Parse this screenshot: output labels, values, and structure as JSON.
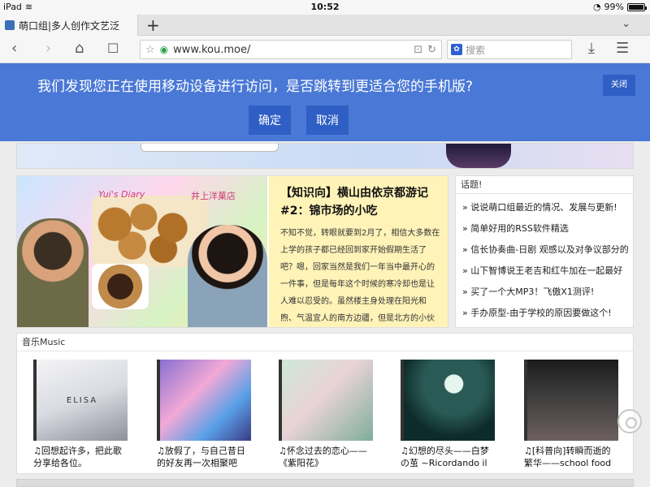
{
  "status_bar": {
    "device": "iPad",
    "time": "10:52",
    "battery": "99%",
    "battery_level": 0.99
  },
  "browser": {
    "tab_title": "萌口组|多人创作文艺泛",
    "new_tab": "+",
    "url": "www.kou.moe/",
    "search_placeholder": "搜索",
    "search_engine_icon": "baidu-paw-icon"
  },
  "overlay": {
    "message": "我们发现您正在使用移动设备进行访问，是否跳转到更适合您的手机版?",
    "confirm": "确定",
    "cancel": "取消",
    "close": "关闭",
    "accent_color": "#4a78d6"
  },
  "feature": {
    "image_caption": "Yui's Diary",
    "image_caption2": "井上洋菓店",
    "title": "【知识向】横山由依京都游记#2：锦市场的小吃",
    "body": "不知不觉，转眼就要到2月了，相信大多数在上学的孩子都已经回到家开始假期生活了吧？嗯，回家当然是我们一年当中最开心的一件事，但是每年这个时候的寒冷却也是让人难以忍受的。虽然楼主身处理在阳光和煦、气温宜人的南方边疆，但是北方的小伙伴们的心情多"
  },
  "topics": {
    "heading": "话题!",
    "items": [
      "» 说说萌口组最近的情况、发展与更新!",
      "» 简单好用的RSS软件精选",
      "» 信长协奏曲-日剧 观感以及对争议部分的",
      "» 山下智博说王老吉和红牛加在一起最好",
      "» 买了一个大MP3！飞傲X1测评!",
      "» 手办原型-由于学校的原因要做这个!"
    ]
  },
  "music": {
    "heading": "音乐Music",
    "items": [
      {
        "cover_text": "ELISA",
        "caption": "♫回想起许多，把此歌分享给各位。"
      },
      {
        "cover_text": "",
        "caption": "♫放假了，与自己昔日的好友再一次相聚吧"
      },
      {
        "cover_text": "",
        "caption": "♫怀念过去的恋心——《紫阳花》"
      },
      {
        "cover_text": "",
        "caption": "♫幻想的尽头——白梦の茧 ~Ricordando il"
      },
      {
        "cover_text": "",
        "caption": "♫[科普向]转瞬而逝的繁华——school food"
      }
    ]
  }
}
